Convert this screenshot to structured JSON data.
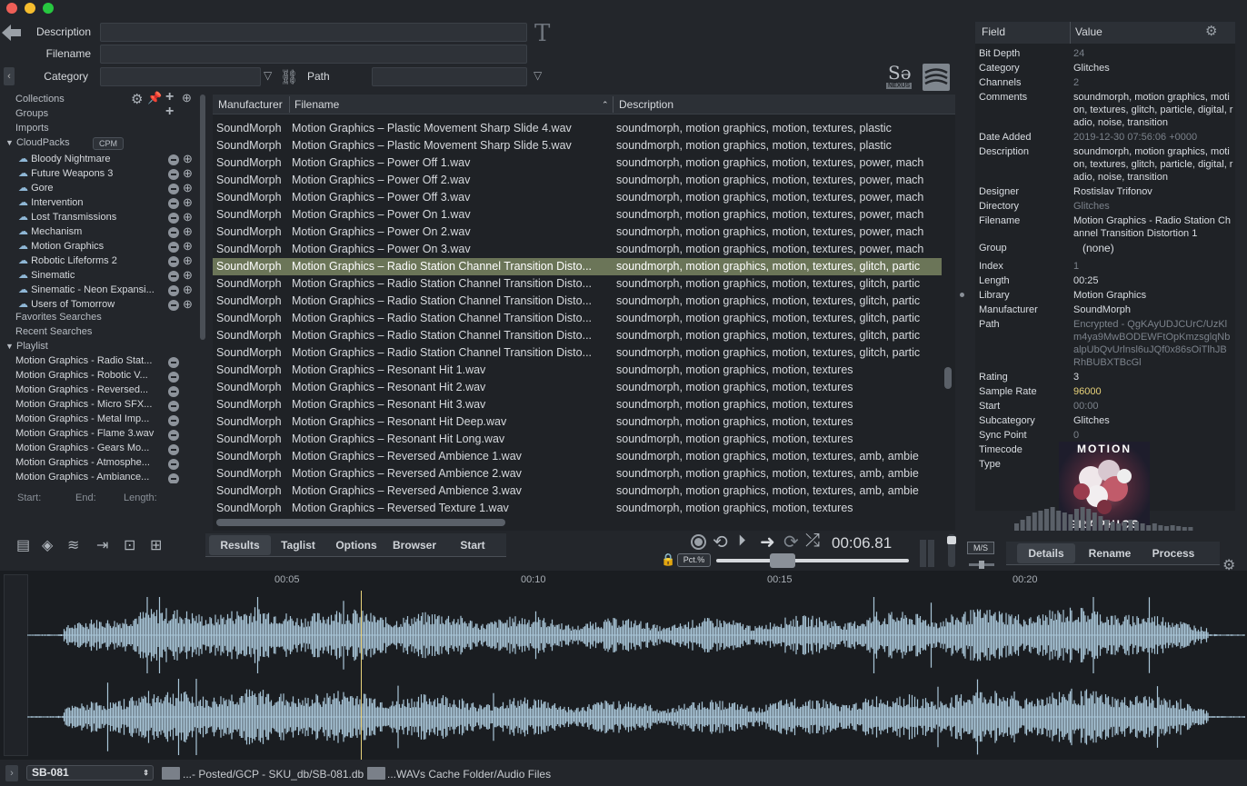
{
  "search": {
    "description_label": "Description",
    "filename_label": "Filename",
    "category_label": "Category",
    "path_label": "Path"
  },
  "logo_text": "NEXUS",
  "sidebar": {
    "collections": "Collections",
    "groups": "Groups",
    "imports": "Imports",
    "cloudpacks": "CloudPacks",
    "cpm_badge": "CPM",
    "packs": [
      "Bloody Nightmare",
      "Future Weapons 3",
      "Gore",
      "Intervention",
      "Lost Transmissions",
      "Mechanism",
      "Motion Graphics",
      "Robotic Lifeforms 2",
      "Sinematic",
      "Sinematic - Neon Expansi...",
      "Users of Tomorrow"
    ],
    "favorites": "Favorites Searches",
    "recent": "Recent Searches",
    "playlist": "Playlist",
    "playlist_items": [
      "Motion Graphics - Radio Stat...",
      "Motion Graphics - Robotic V...",
      "Motion Graphics - Reversed...",
      "Motion Graphics - Micro SFX...",
      "Motion Graphics - Metal Imp...",
      "Motion Graphics - Flame 3.wav",
      "Motion Graphics - Gears Mo...",
      "Motion Graphics - Atmosphe...",
      "Motion Graphics - Ambiance..."
    ],
    "start_label": "Start:",
    "end_label": "End:",
    "length_label": "Length:"
  },
  "table": {
    "columns": [
      "Manufacturer",
      "Filename",
      "Description"
    ],
    "rows": [
      [
        "SoundMorph",
        "Motion Graphics – Plastic Movement Sharp Slide 4.wav",
        "soundmorph, motion graphics, motion, textures, plastic"
      ],
      [
        "SoundMorph",
        "Motion Graphics – Plastic Movement Sharp Slide 5.wav",
        "soundmorph, motion graphics, motion, textures, plastic"
      ],
      [
        "SoundMorph",
        "Motion Graphics – Power Off 1.wav",
        "soundmorph, motion graphics, motion, textures, power, mach"
      ],
      [
        "SoundMorph",
        "Motion Graphics – Power Off 2.wav",
        "soundmorph, motion graphics, motion, textures, power, mach"
      ],
      [
        "SoundMorph",
        "Motion Graphics – Power Off 3.wav",
        "soundmorph, motion graphics, motion, textures, power, mach"
      ],
      [
        "SoundMorph",
        "Motion Graphics – Power On 1.wav",
        "soundmorph, motion graphics, motion, textures, power, mach"
      ],
      [
        "SoundMorph",
        "Motion Graphics – Power On 2.wav",
        "soundmorph, motion graphics, motion, textures, power, mach"
      ],
      [
        "SoundMorph",
        "Motion Graphics – Power On 3.wav",
        "soundmorph, motion graphics, motion, textures, power, mach"
      ],
      [
        "SoundMorph",
        "Motion Graphics – Radio Station Channel Transition Disto...",
        "soundmorph, motion graphics, motion, textures, glitch, partic"
      ],
      [
        "SoundMorph",
        "Motion Graphics – Radio Station Channel Transition Disto...",
        "soundmorph, motion graphics, motion, textures, glitch, partic"
      ],
      [
        "SoundMorph",
        "Motion Graphics – Radio Station Channel Transition Disto...",
        "soundmorph, motion graphics, motion, textures, glitch, partic"
      ],
      [
        "SoundMorph",
        "Motion Graphics – Radio Station Channel Transition Disto...",
        "soundmorph, motion graphics, motion, textures, glitch, partic"
      ],
      [
        "SoundMorph",
        "Motion Graphics – Radio Station Channel Transition Disto...",
        "soundmorph, motion graphics, motion, textures, glitch, partic"
      ],
      [
        "SoundMorph",
        "Motion Graphics – Radio Station Channel Transition Disto...",
        "soundmorph, motion graphics, motion, textures, glitch, partic"
      ],
      [
        "SoundMorph",
        "Motion Graphics – Resonant Hit 1.wav",
        "soundmorph, motion graphics, motion, textures"
      ],
      [
        "SoundMorph",
        "Motion Graphics – Resonant Hit 2.wav",
        "soundmorph, motion graphics, motion, textures"
      ],
      [
        "SoundMorph",
        "Motion Graphics – Resonant Hit 3.wav",
        "soundmorph, motion graphics, motion, textures"
      ],
      [
        "SoundMorph",
        "Motion Graphics – Resonant Hit Deep.wav",
        "soundmorph, motion graphics, motion, textures"
      ],
      [
        "SoundMorph",
        "Motion Graphics – Resonant Hit Long.wav",
        "soundmorph, motion graphics, motion, textures"
      ],
      [
        "SoundMorph",
        "Motion Graphics – Reversed Ambience 1.wav",
        "soundmorph, motion graphics, motion, textures, amb, ambie"
      ],
      [
        "SoundMorph",
        "Motion Graphics – Reversed Ambience 2.wav",
        "soundmorph, motion graphics, motion, textures, amb, ambie"
      ],
      [
        "SoundMorph",
        "Motion Graphics – Reversed Ambience 3.wav",
        "soundmorph, motion graphics, motion, textures, amb, ambie"
      ],
      [
        "SoundMorph",
        "Motion Graphics – Reversed Texture 1.wav",
        "soundmorph, motion graphics, motion, textures"
      ]
    ],
    "selected_index": 8
  },
  "tabs_left": [
    "Results",
    "Taglist",
    "Options",
    "Browser",
    "Start"
  ],
  "transport": {
    "time": "00:06.81",
    "pct_label": "Pct.%",
    "ms_label": "M/S"
  },
  "tabs_right": [
    "Details",
    "Rename",
    "Process"
  ],
  "metadata": {
    "field_header": "Field",
    "value_header": "Value",
    "rows": [
      {
        "k": "Bit Depth",
        "v": "24",
        "dim": true
      },
      {
        "k": "Category",
        "v": "Glitches",
        "dim": false
      },
      {
        "k": "Channels",
        "v": "2",
        "dim": true
      },
      {
        "k": "Comments",
        "v": "soundmorph, motion graphics, motion, textures, glitch, particle, digital, radio, noise, transition",
        "dim": false
      },
      {
        "k": "Date Added",
        "v": "2019-12-30 07:56:06 +0000",
        "dim": true
      },
      {
        "k": "Description",
        "v": "soundmorph, motion graphics, motion, textures, glitch, particle, digital, radio, noise, transition",
        "dim": false
      },
      {
        "k": "Designer",
        "v": "Rostislav Trifonov",
        "dim": false
      },
      {
        "k": "Directory",
        "v": "Glitches",
        "dim": true
      },
      {
        "k": "Filename",
        "v": "Motion Graphics - Radio Station Channel Transition Distortion 1",
        "dim": false
      },
      {
        "k": "Group",
        "v": "(none)",
        "dim": false
      },
      {
        "k": "Index",
        "v": "1",
        "dim": true
      },
      {
        "k": "Length",
        "v": "00:25",
        "dim": false
      },
      {
        "k": "Library",
        "v": "Motion Graphics",
        "dim": false
      },
      {
        "k": "Manufacturer",
        "v": "SoundMorph",
        "dim": false
      },
      {
        "k": "Path",
        "v": "Encrypted - QgKAyUDJCUrC/UzKlm4ya9MwBODEWFtOpKmzsglqNbalpUbQvUrlnsl6uJQf0x86sOiTlhJBRhBUBXTBcGl",
        "dim": true
      },
      {
        "k": "Rating",
        "v": "3",
        "dim": false
      },
      {
        "k": "Sample Rate",
        "v": "96000",
        "dim": false,
        "accent": true
      },
      {
        "k": "Start",
        "v": "00:00",
        "dim": true
      },
      {
        "k": "Subcategory",
        "v": "Glitches",
        "dim": false
      },
      {
        "k": "Sync Point",
        "v": "0",
        "dim": true
      },
      {
        "k": "Timecode",
        "v": "",
        "dim": false
      },
      {
        "k": "Type",
        "v": "",
        "dim": false
      }
    ],
    "artwork_top": "MOTION",
    "artwork_bottom": "GRAPHICS"
  },
  "timeline": {
    "ticks": [
      "00:05",
      "00:10",
      "00:15",
      "00:20"
    ]
  },
  "statusbar": {
    "db_select": "SB-081",
    "path1": "...- Posted/GCP - SKU_db/SB-081.db",
    "path2": "...WAVs Cache Folder/Audio Files"
  },
  "colors": {
    "accent_yellow": "#e8d27a",
    "selection": "#6b7558",
    "waveform": "#a9c6d8"
  }
}
